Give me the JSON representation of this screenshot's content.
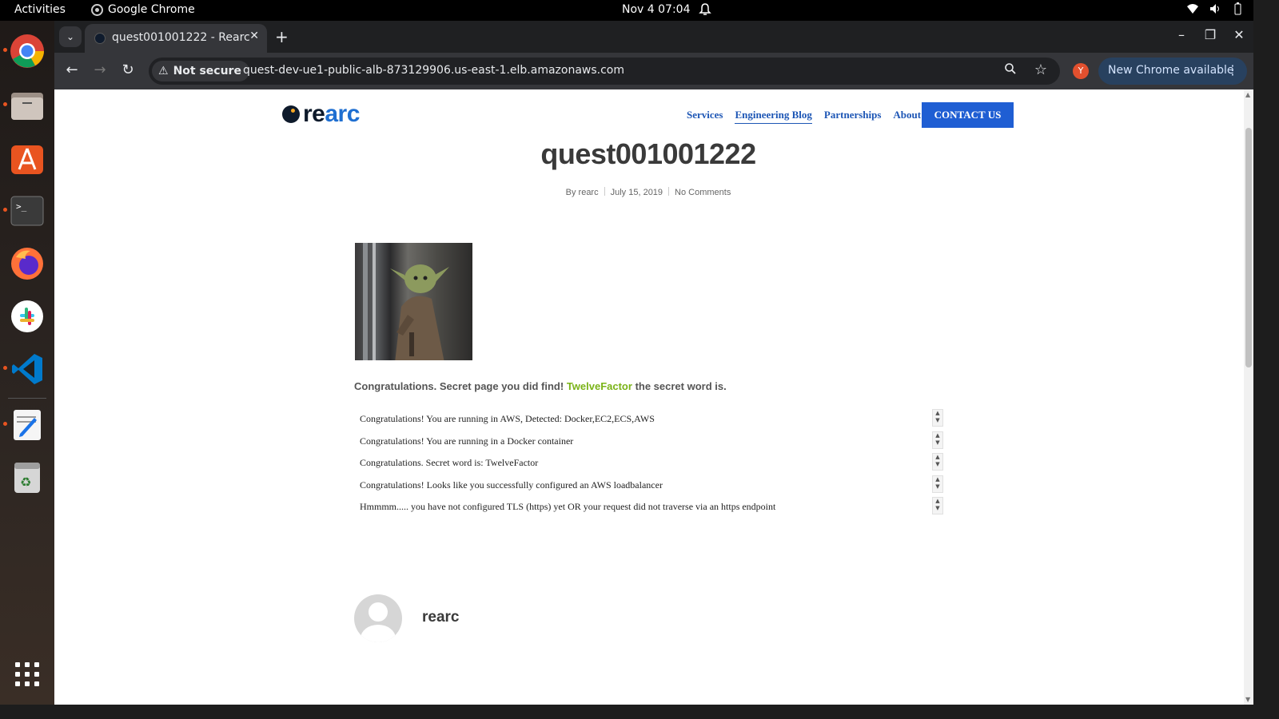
{
  "topbar": {
    "activities": "Activities",
    "app_name": "Google Chrome",
    "clock": "Nov 4  07:04"
  },
  "dock": {
    "items": [
      {
        "name": "chrome-icon",
        "running": true
      },
      {
        "name": "files-icon",
        "running": true
      },
      {
        "name": "app-center-icon",
        "running": false
      },
      {
        "name": "terminal-icon",
        "running": true
      },
      {
        "name": "firefox-icon",
        "running": false
      },
      {
        "name": "slack-icon",
        "running": false
      },
      {
        "name": "vscode-icon",
        "running": true
      },
      {
        "name": "text-editor-icon",
        "running": true
      },
      {
        "name": "trash-icon",
        "running": false
      },
      {
        "name": "app-grid-icon",
        "running": false
      }
    ]
  },
  "browser": {
    "tab_title": "quest001001222 - Rearc",
    "security_label": "Not secure",
    "url": "quest-dev-ue1-public-alb-873129906.us-east-1.elb.amazonaws.com",
    "profile_initial": "Y",
    "update_label": "New Chrome available"
  },
  "site": {
    "logo_prefix": "re",
    "logo_suffix": "arc",
    "nav": [
      {
        "label": "Services",
        "active": false
      },
      {
        "label": "Engineering Blog",
        "active": true
      },
      {
        "label": "Partnerships",
        "active": false
      },
      {
        "label": "About",
        "active": false
      }
    ],
    "contact_label": "CONTACT US"
  },
  "post": {
    "title": "quest001001222",
    "meta_author": "By rearc",
    "meta_date": "July 15, 2019",
    "meta_comments": "No Comments",
    "congrats_before": "Congratulations. Secret page you did find!",
    "congrats_secret": "TwelveFactor",
    "congrats_after": "the secret word is.",
    "messages": [
      "Congratulations! You are running in AWS, Detected: Docker,EC2,ECS,AWS",
      "Congratulations! You are running in a Docker container",
      "Congratulations. Secret word is: TwelveFactor",
      "Congratulations! Looks like you successfully configured an AWS loadbalancer",
      "Hmmmm..... you have not configured TLS (https) yet OR your request did not traverse via an https endpoint"
    ],
    "author_name": "rearc"
  },
  "colors": {
    "nav_link": "#1d56b5",
    "contact_bg": "#1f5ed3",
    "secret_word": "#7ab317"
  }
}
